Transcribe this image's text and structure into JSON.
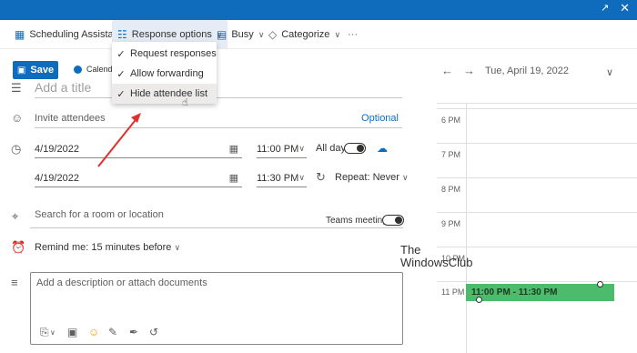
{
  "toolbar": {
    "scheduling_assistant": "Scheduling Assistant",
    "response_options": "Response options",
    "busy": "Busy",
    "categorize": "Categorize",
    "more": "···"
  },
  "save_label": "Save",
  "calendar_label": "Calendar",
  "response_menu": {
    "items": [
      {
        "label": "Request responses",
        "checked": true
      },
      {
        "label": "Allow forwarding",
        "checked": true
      },
      {
        "label": "Hide attendee list",
        "checked": true
      }
    ]
  },
  "form": {
    "title_placeholder": "Add a title",
    "attendees_placeholder": "Invite attendees",
    "optional_label": "Optional",
    "start_date": "4/19/2022",
    "start_time": "11:00 PM",
    "end_date": "4/19/2022",
    "end_time": "11:30 PM",
    "all_day_label": "All day",
    "repeat_label": "Repeat:",
    "repeat_value": "Never",
    "location_placeholder": "Search for a room or location",
    "teams_label": "Teams meeting",
    "reminder_label": "Remind me: 15 minutes before",
    "description_placeholder": "Add a description or attach documents"
  },
  "calendar": {
    "date": "Tue, April 19, 2022",
    "hours": [
      "6 PM",
      "7 PM",
      "8 PM",
      "9 PM",
      "10 PM",
      "11 PM"
    ],
    "event": "11:00 PM - 11:30 PM",
    "event_color": "#4cbb6b"
  },
  "watermark": {
    "line1": "The",
    "line2": "WindowsClub"
  },
  "colors": {
    "accent": "#0f6cbd"
  }
}
